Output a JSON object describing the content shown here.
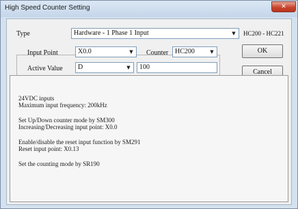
{
  "window": {
    "title": "High Speed Counter Setting",
    "close_glyph": "✕"
  },
  "type_row": {
    "label": "Type",
    "value": "Hardware - 1 Phase 1 Input",
    "range": "HC200 - HC221"
  },
  "input_point": {
    "label": "Input Point",
    "value": "X0.0"
  },
  "counter": {
    "label": "Counter",
    "value": "HC200"
  },
  "active_value": {
    "label": "Active Value",
    "select": "D",
    "input": "100"
  },
  "buttons": {
    "ok": "OK",
    "cancel": "Cancel"
  },
  "info": {
    "line1": "24VDC inputs",
    "line2": "Maximum input frequency: 200kHz",
    "line3": "Set Up/Down counter mode by SM300",
    "line4": "Increasing/Decreasing input point: X0.0",
    "line5": "Enable/disable the reset input function by SM291",
    "line6": "Reset input point: X0.13",
    "line7": "Set the counting mode by SR190"
  },
  "icons": {
    "dropdown": "chevron-down-icon"
  }
}
